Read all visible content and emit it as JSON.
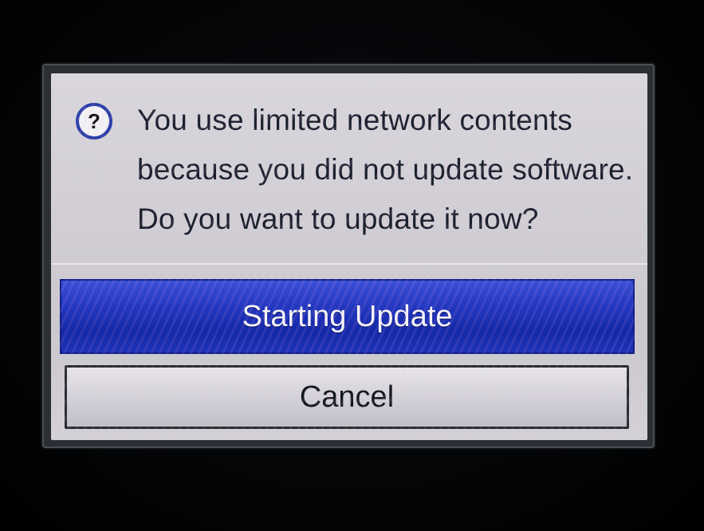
{
  "dialog": {
    "icon": "question-icon",
    "icon_glyph": "?",
    "message_lines": [
      "You use limited network contents",
      "because you did not update software.",
      "Do you want to update it now?"
    ],
    "buttons": {
      "primary_label": "Starting Update",
      "secondary_label": "Cancel"
    }
  },
  "colors": {
    "accent_blue": "#2238c0",
    "dialog_bg": "#d2d2d6",
    "text_dark": "#1b1f2e",
    "icon_ring": "#2b3ea8"
  }
}
